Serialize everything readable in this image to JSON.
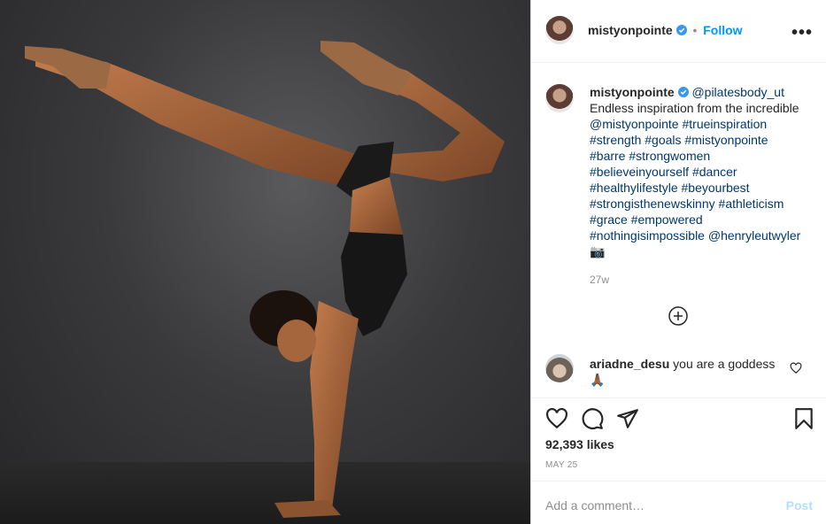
{
  "post": {
    "username": "mistyonpointe",
    "follow_label": "Follow",
    "separator": "•",
    "more_icon": "more-options-icon",
    "caption": {
      "mention_lead": "@pilatesbody_ut",
      "text": "Endless inspiration from the incredible",
      "body_links": [
        "@mistyonpointe",
        "#trueinspiration",
        "#strength",
        "#goals",
        "#mistyonpointe",
        "#barre",
        "#strongwomen",
        "#believeinyourself",
        "#dancer",
        "#healthylifestyle",
        "#beyourbest",
        "#strongisthenewskinny",
        "#athleticism",
        "#grace",
        "#empowered",
        "#nothingisimpossible",
        "@henryleutwyler"
      ],
      "camera_emoji": "📷",
      "age": "27w"
    },
    "load_more_icon": "plus-circle-icon",
    "comments": [
      {
        "username": "ariadne_desu",
        "text": "you are a goddess",
        "emoji": "🙏🏾"
      }
    ],
    "likes": "92,393 likes",
    "date": "MAY 25",
    "add_comment_placeholder": "Add a comment…",
    "post_label": "Post"
  },
  "colors": {
    "link": "#00376b",
    "follow": "#0095f6",
    "verified": "#3897f0",
    "post_disabled": "#b2dffc"
  }
}
